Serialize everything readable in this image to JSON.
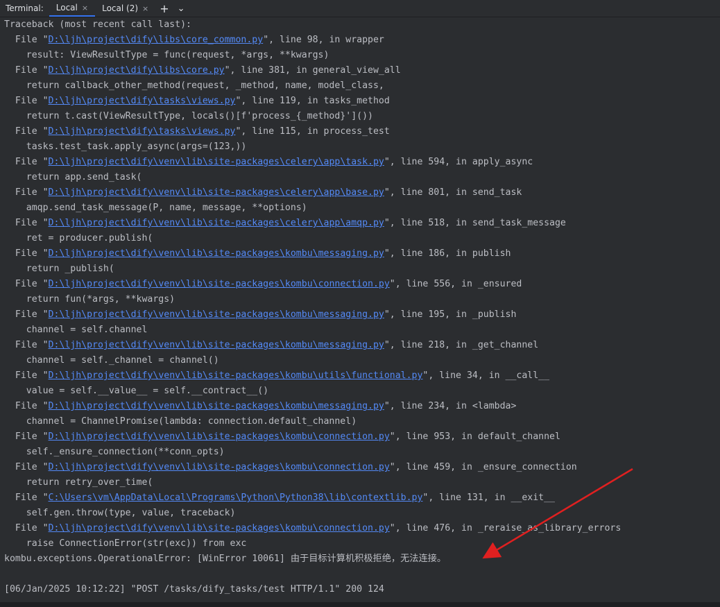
{
  "tabbar": {
    "label": "Terminal:",
    "tabs": [
      {
        "label": "Local",
        "close": "×"
      },
      {
        "label": "Local (2)",
        "close": "×"
      }
    ],
    "add": "+",
    "menu": "⌄"
  },
  "terminal": {
    "lines": [
      [
        "Traceback (most recent call last):"
      ],
      [
        "  File \"",
        {
          "link": "D:\\ljh\\project\\dify\\libs\\core_common.py"
        },
        "\", line 98, in wrapper"
      ],
      [
        "    result: ViewResultType = func(request, *args, **kwargs)"
      ],
      [
        "  File \"",
        {
          "link": "D:\\ljh\\project\\dify\\libs\\core.py"
        },
        "\", line 381, in general_view_all"
      ],
      [
        "    return callback_other_method(request, _method, name, model_class,"
      ],
      [
        "  File \"",
        {
          "link": "D:\\ljh\\project\\dify\\tasks\\views.py"
        },
        "\", line 119, in tasks_method"
      ],
      [
        "    return t.cast(ViewResultType, locals()[f'process_{_method}']())"
      ],
      [
        "  File \"",
        {
          "link": "D:\\ljh\\project\\dify\\tasks\\views.py"
        },
        "\", line 115, in process_test"
      ],
      [
        "    tasks.test_task.apply_async(args=(123,))"
      ],
      [
        "  File \"",
        {
          "link": "D:\\ljh\\project\\dify\\venv\\lib\\site-packages\\celery\\app\\task.py"
        },
        "\", line 594, in apply_async"
      ],
      [
        "    return app.send_task("
      ],
      [
        "  File \"",
        {
          "link": "D:\\ljh\\project\\dify\\venv\\lib\\site-packages\\celery\\app\\base.py"
        },
        "\", line 801, in send_task"
      ],
      [
        "    amqp.send_task_message(P, name, message, **options)"
      ],
      [
        "  File \"",
        {
          "link": "D:\\ljh\\project\\dify\\venv\\lib\\site-packages\\celery\\app\\amqp.py"
        },
        "\", line 518, in send_task_message"
      ],
      [
        "    ret = producer.publish("
      ],
      [
        "  File \"",
        {
          "link": "D:\\ljh\\project\\dify\\venv\\lib\\site-packages\\kombu\\messaging.py"
        },
        "\", line 186, in publish"
      ],
      [
        "    return _publish("
      ],
      [
        "  File \"",
        {
          "link": "D:\\ljh\\project\\dify\\venv\\lib\\site-packages\\kombu\\connection.py"
        },
        "\", line 556, in _ensured"
      ],
      [
        "    return fun(*args, **kwargs)"
      ],
      [
        "  File \"",
        {
          "link": "D:\\ljh\\project\\dify\\venv\\lib\\site-packages\\kombu\\messaging.py"
        },
        "\", line 195, in _publish"
      ],
      [
        "    channel = self.channel"
      ],
      [
        "  File \"",
        {
          "link": "D:\\ljh\\project\\dify\\venv\\lib\\site-packages\\kombu\\messaging.py"
        },
        "\", line 218, in _get_channel"
      ],
      [
        "    channel = self._channel = channel()"
      ],
      [
        "  File \"",
        {
          "link": "D:\\ljh\\project\\dify\\venv\\lib\\site-packages\\kombu\\utils\\functional.py"
        },
        "\", line 34, in __call__"
      ],
      [
        "    value = self.__value__ = self.__contract__()"
      ],
      [
        "  File \"",
        {
          "link": "D:\\ljh\\project\\dify\\venv\\lib\\site-packages\\kombu\\messaging.py"
        },
        "\", line 234, in <lambda>"
      ],
      [
        "    channel = ChannelPromise(lambda: connection.default_channel)"
      ],
      [
        "  File \"",
        {
          "link": "D:\\ljh\\project\\dify\\venv\\lib\\site-packages\\kombu\\connection.py"
        },
        "\", line 953, in default_channel"
      ],
      [
        "    self._ensure_connection(**conn_opts)"
      ],
      [
        "  File \"",
        {
          "link": "D:\\ljh\\project\\dify\\venv\\lib\\site-packages\\kombu\\connection.py"
        },
        "\", line 459, in _ensure_connection"
      ],
      [
        "    return retry_over_time("
      ],
      [
        "  File \"",
        {
          "link": "C:\\Users\\vm\\AppData\\Local\\Programs\\Python\\Python38\\lib\\contextlib.py"
        },
        "\", line 131, in __exit__"
      ],
      [
        "    self.gen.throw(type, value, traceback)"
      ],
      [
        "  File \"",
        {
          "link": "D:\\ljh\\project\\dify\\venv\\lib\\site-packages\\kombu\\connection.py"
        },
        "\", line 476, in _reraise_as_library_errors"
      ],
      [
        "    raise ConnectionError(str(exc)) from exc"
      ],
      [
        "kombu.exceptions.OperationalError: [WinError 10061] 由于目标计算机积极拒绝，无法连接。"
      ],
      [
        ""
      ],
      [
        "[06/Jan/2025 10:12:22] \"POST /tasks/dify_tasks/test HTTP/1.1\" 200 124"
      ]
    ]
  },
  "annotation": {
    "color": "#e02020"
  }
}
